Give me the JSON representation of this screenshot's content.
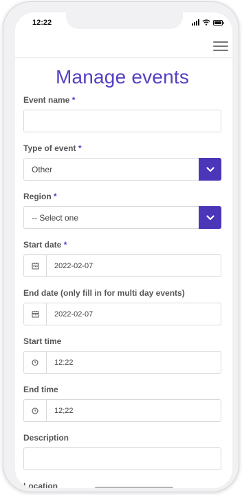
{
  "status_bar": {
    "time": "12:22"
  },
  "colors": {
    "accent": "#5340c2",
    "select_button": "#4b35b8"
  },
  "header": {
    "menu_icon": "hamburger-icon"
  },
  "page": {
    "title": "Manage events"
  },
  "form": {
    "required_mark": "*",
    "event_name": {
      "label": "Event name",
      "value": ""
    },
    "event_type": {
      "label": "Type of event",
      "value": "Other"
    },
    "region": {
      "label": "Region",
      "value": "-- Select one"
    },
    "start_date": {
      "label": "Start date",
      "value": "2022-02-07",
      "icon": "calendar-icon"
    },
    "end_date": {
      "label": "End date (only fill in for multi day events)",
      "value": "2022-02-07",
      "icon": "calendar-icon"
    },
    "start_time": {
      "label": "Start time",
      "value": "12:22",
      "icon": "clock-icon"
    },
    "end_time": {
      "label": "End time",
      "value": "12;22",
      "icon": "clock-icon"
    },
    "description": {
      "label": "Description",
      "value": ""
    },
    "location": {
      "label": "Location"
    }
  }
}
